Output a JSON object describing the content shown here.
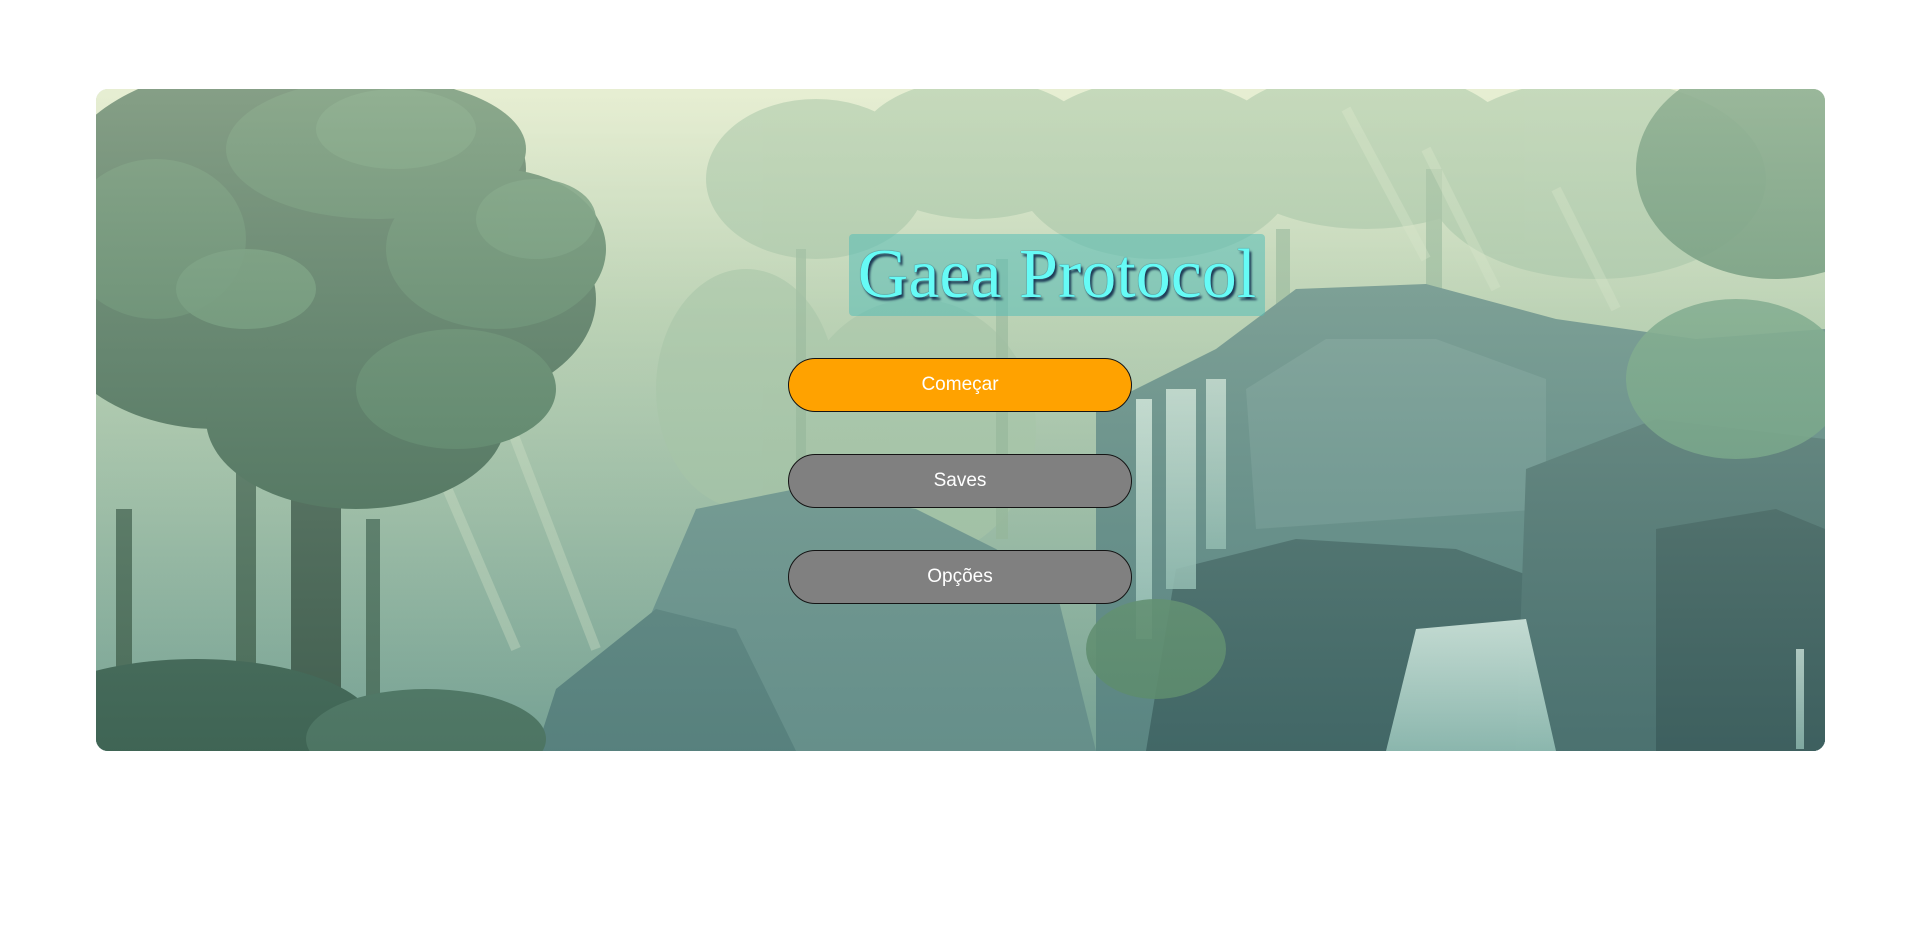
{
  "game": {
    "title": "Gaea Protocol"
  },
  "menu": {
    "start_label": "Começar",
    "saves_label": "Saves",
    "options_label": "Opções"
  },
  "colors": {
    "start_button": "#ffa200",
    "secondary_button": "#808080",
    "title_text": "#66fbf6",
    "title_box": "#58beb6"
  },
  "background": {
    "icon": "pixel-art-forest-waterfall-scene"
  }
}
